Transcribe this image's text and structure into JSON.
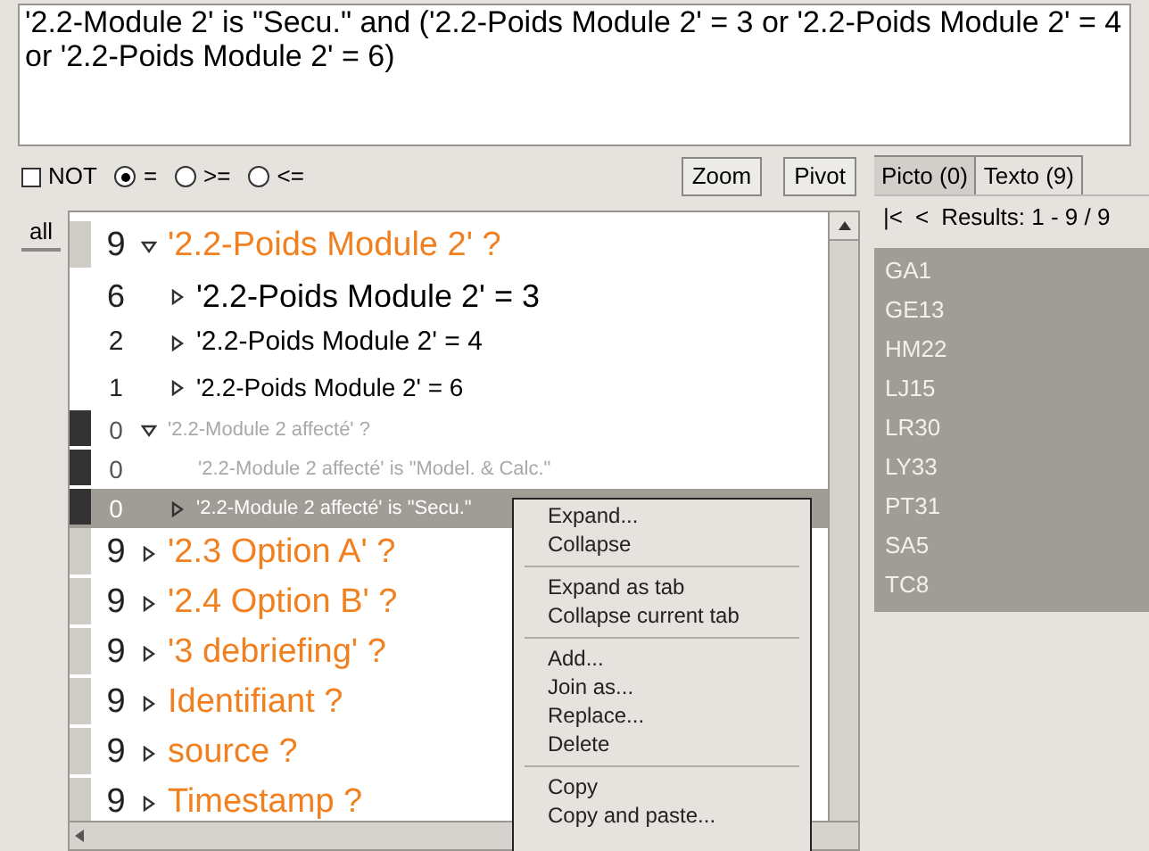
{
  "query": "'2.2-Module 2' is \"Secu.\" and ('2.2-Poids Module 2' = 3 or '2.2-Poids Module 2' = 4 or '2.2-Poids Module 2' = 6)",
  "options": [
    {
      "kind": "checkbox",
      "label": "NOT",
      "checked": false
    },
    {
      "kind": "radio",
      "label": "=",
      "selected": true
    },
    {
      "kind": "radio",
      "label": ">=",
      "selected": false
    },
    {
      "kind": "radio",
      "label": "<=",
      "selected": false
    }
  ],
  "buttons": [
    "Zoom",
    "Pivot"
  ],
  "side_tab": "all",
  "tree": [
    {
      "count": "9",
      "label": "'2.2-Poids Module 2' ?",
      "kind": "question",
      "expanded": true,
      "disabled": false,
      "selected": false,
      "children": [
        {
          "count": "6",
          "label": "'2.2-Poids Module 2' = 3",
          "kind": "value",
          "expanded": false,
          "disabled": false,
          "selected": false
        },
        {
          "count": "2",
          "label": "'2.2-Poids Module 2' = 4",
          "kind": "value",
          "expanded": false,
          "disabled": false,
          "selected": false
        },
        {
          "count": "1",
          "label": "'2.2-Poids Module 2' = 6",
          "kind": "value",
          "expanded": false,
          "disabled": false,
          "selected": false
        }
      ]
    },
    {
      "count": "0",
      "label": "'2.2-Module 2 affecté' ?",
      "expanded": true,
      "disabled": true,
      "selected": false,
      "children": [
        {
          "count": "0",
          "label": "'2.2-Module 2 affecté' is \"Model. & Calc.\"",
          "disabled": true,
          "selected": false
        },
        {
          "count": "0",
          "label": "'2.2-Module 2 affecté' is \"Secu.\"",
          "expanded": false,
          "disabled": true,
          "selected": true
        }
      ]
    },
    {
      "count": "9",
      "label": "'2.3 Option A' ?",
      "kind": "question",
      "expanded": false,
      "disabled": false,
      "selected": false
    },
    {
      "count": "9",
      "label": "'2.4 Option B' ?",
      "kind": "question",
      "expanded": false,
      "disabled": false,
      "selected": false
    },
    {
      "count": "9",
      "label": "'3 debriefing' ?",
      "kind": "question",
      "expanded": false,
      "disabled": false,
      "selected": false
    },
    {
      "count": "9",
      "label": "Identifiant ?",
      "kind": "question",
      "expanded": false,
      "disabled": false,
      "selected": false
    },
    {
      "count": "9",
      "label": "source ?",
      "kind": "question",
      "expanded": false,
      "disabled": false,
      "selected": false
    },
    {
      "count": "9",
      "label": "Timestamp ?",
      "kind": "question",
      "expanded": false,
      "disabled": false,
      "selected": false
    }
  ],
  "context_menu": [
    [
      "Expand...",
      "Collapse"
    ],
    [
      "Expand as tab",
      "Collapse current tab"
    ],
    [
      "Add...",
      "Join as...",
      "Replace...",
      "Delete"
    ],
    [
      "Copy",
      "Copy and paste..."
    ]
  ],
  "tabs": [
    {
      "label": "Picto (0)",
      "selected": false
    },
    {
      "label": "Texto (9)",
      "selected": true
    }
  ],
  "nav": {
    "first": "|<",
    "prev": "<",
    "results": "Results: 1 - 9 / 9"
  },
  "results": [
    {
      "label": "GA1",
      "selected": true
    },
    {
      "label": "GE13",
      "selected": true
    },
    {
      "label": "HM22",
      "selected": true
    },
    {
      "label": "LJ15",
      "selected": true
    },
    {
      "label": "LR30",
      "selected": true
    },
    {
      "label": "LY33",
      "selected": true
    },
    {
      "label": "PT31",
      "selected": true
    },
    {
      "label": "SA5",
      "selected": true
    },
    {
      "label": "TC8",
      "selected": true
    }
  ]
}
